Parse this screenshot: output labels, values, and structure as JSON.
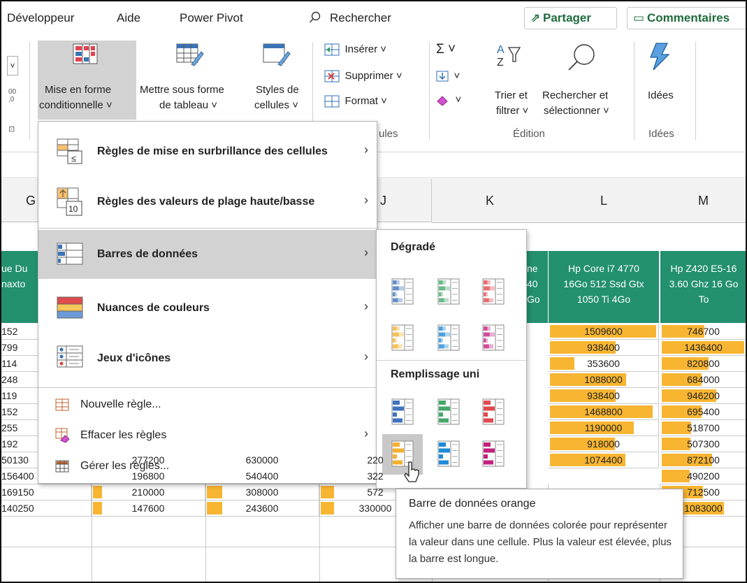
{
  "tabs": {
    "developer": "Développeur",
    "help": "Aide",
    "power_pivot": "Power Pivot",
    "search": "Rechercher",
    "share": "Partager",
    "comments": "Commentaires"
  },
  "ribbon": {
    "mise_en_forme_line1": "Mise en forme",
    "mise_en_forme_line2": "conditionnelle ˅",
    "tableau_line1": "Mettre sous forme",
    "tableau_line2": "de tableau ˅",
    "styles_line1": "Styles de",
    "styles_line2": "cellules ˅",
    "inserer": "Insérer ˅",
    "supprimer": "Supprimer ˅",
    "format": "Format ˅",
    "cellules_group": "ules",
    "trier_line1": "Trier et",
    "trier_line2": "filtrer ˅",
    "rechercher_line1": "Rechercher et",
    "rechercher_line2": "sélectionner ˅",
    "edition_group": "Édition",
    "idees": "Idées",
    "idees_group": "Idées",
    "sigma": "Σ ˅",
    "fill": "˅",
    "eraser": "˅"
  },
  "menu": {
    "item1": "Règles de mise en surbrillance des cellules",
    "item2": "Règles des valeurs de plage haute/basse",
    "item3": "Barres de données",
    "item4": "Nuances de couleurs",
    "item5": "Jeux d'icônes",
    "item6": "Nouvelle règle...",
    "item7": "Effacer les règles",
    "item8": "Gérer les règles..."
  },
  "submenu": {
    "gradient": "Dégradé",
    "solid": "Remplissage uni"
  },
  "tooltip": {
    "title": "Barre de données orange",
    "body": "Afficher une barre de données colorée pour représenter la valeur dans une cellule. Plus la valeur est élevée, plus la barre est longue."
  },
  "columns": {
    "G": "G",
    "J": "J",
    "K": "K",
    "L": "L",
    "M": "M"
  },
  "headers": {
    "g_partial_1": "ue Du",
    "g_partial_2": "naxto",
    "j_partial_1": "ne",
    "j_partial_2": "40",
    "j_partial_3": "Go",
    "l_1": "Hp Core i7 4770",
    "l_2": "16Go 512 Ssd Gtx",
    "l_3": "1050 Ti 4Go",
    "m_1": "Hp Z420 E5-16",
    "m_2": "3.60 Ghz 16 Go",
    "m_3": "To"
  },
  "col_g_values": [
    "152",
    "799",
    "114",
    "248",
    "119",
    "152",
    "255",
    "192",
    "50130",
    "156400",
    "169150",
    "140250"
  ],
  "col_h_values": [
    "277200",
    "196800",
    "210000",
    "147600"
  ],
  "col_i_values": [
    "630000",
    "540400",
    "308000",
    "243600"
  ],
  "col_j_values": [
    "220",
    "322",
    "572",
    "330000"
  ],
  "col_l_values": [
    "1509600",
    "938400",
    "353600",
    "1088000",
    "938400",
    "1468800",
    "1190000",
    "918000",
    "1074400"
  ],
  "col_l_fill": [
    1.0,
    0.62,
    0.23,
    0.72,
    0.62,
    0.97,
    0.79,
    0.61,
    0.71
  ],
  "col_m_values": [
    "746700",
    "1436400",
    "820800",
    "684000",
    "946200",
    "695400",
    "518700",
    "507300",
    "872100",
    "490200",
    "712500",
    "1083000"
  ],
  "col_m_fill": [
    0.52,
    1.0,
    0.57,
    0.48,
    0.66,
    0.48,
    0.36,
    0.35,
    0.61,
    0.34,
    0.5,
    0.75
  ]
}
